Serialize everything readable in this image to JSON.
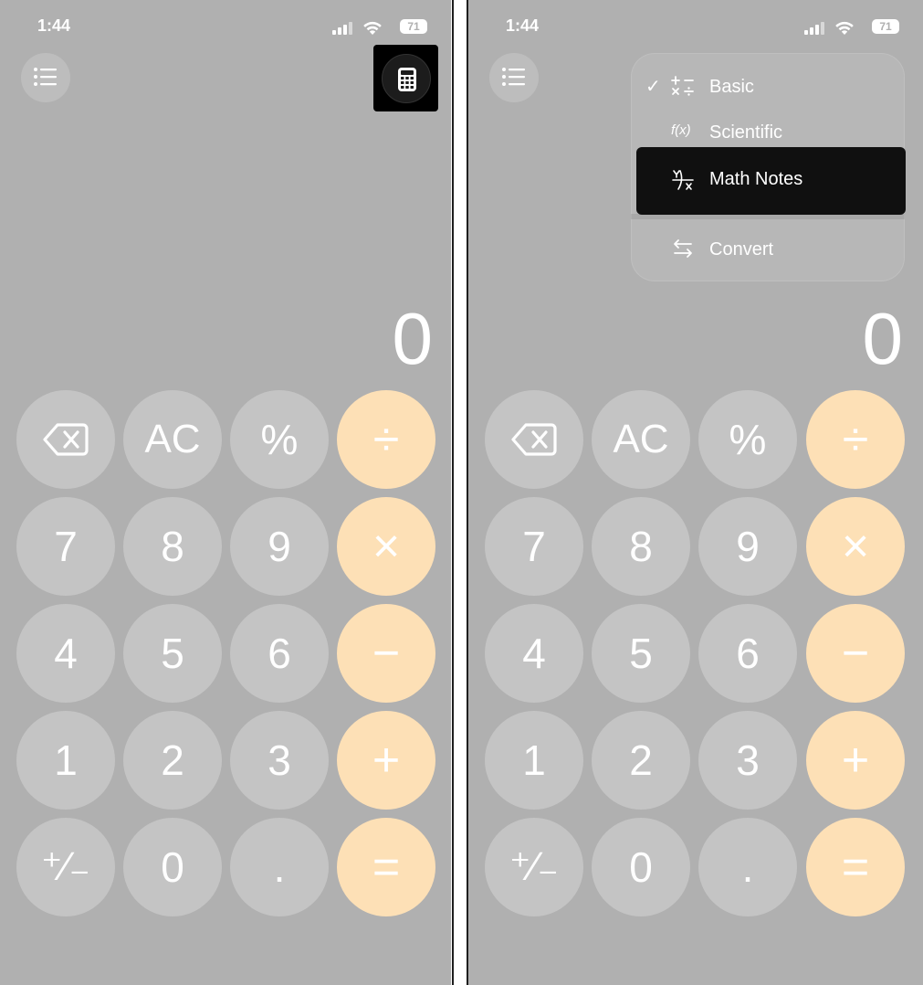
{
  "status": {
    "time": "1:44",
    "battery": "71"
  },
  "display": {
    "value": "0"
  },
  "keys": {
    "row1": [
      "",
      "AC",
      "%",
      "÷"
    ],
    "row2": [
      "7",
      "8",
      "9",
      "×"
    ],
    "row3": [
      "4",
      "5",
      "6",
      "−"
    ],
    "row4": [
      "1",
      "2",
      "3",
      "+"
    ],
    "row5": [
      "⁺∕₋",
      "0",
      ".",
      "="
    ]
  },
  "menu": {
    "items": [
      {
        "label": "Basic",
        "checked": true,
        "icon": "basic-ops-icon"
      },
      {
        "label": "Scientific",
        "checked": false,
        "icon": "function-icon"
      },
      {
        "label": "Math Notes",
        "checked": false,
        "icon": "math-notes-icon"
      },
      {
        "label": "Convert",
        "checked": false,
        "icon": "convert-arrows-icon"
      }
    ],
    "check_glyph": "✓",
    "scientific_glyph": "f(x)"
  },
  "colors": {
    "background": "#b0b0b0",
    "key": "#c4c4c4",
    "operator_key": "#fde0b6",
    "highlight": "#000000"
  }
}
